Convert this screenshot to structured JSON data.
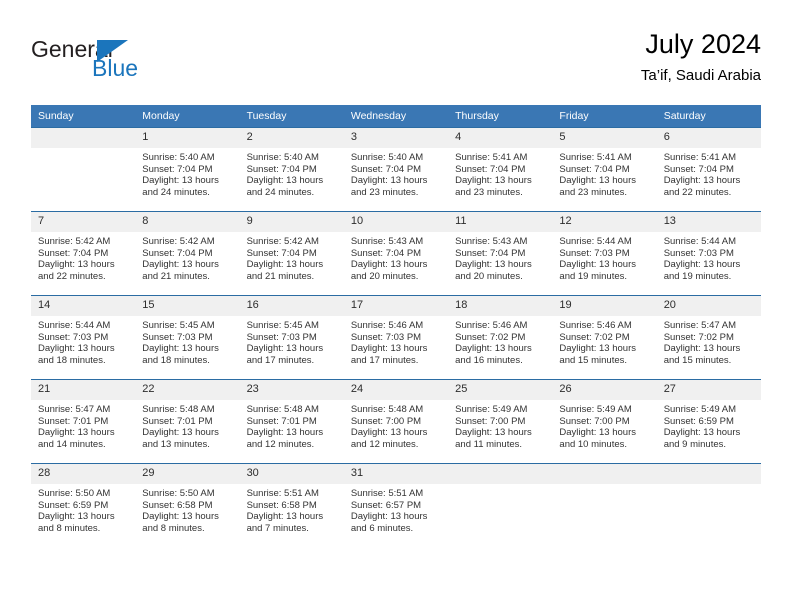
{
  "brand": {
    "name_part1": "General",
    "name_part2": "Blue",
    "accent_color": "#1b75bc"
  },
  "header": {
    "title": "July 2024",
    "subtitle": "Ta’if, Saudi Arabia"
  },
  "theme": {
    "header_row_bg": "#3a77b4",
    "daynum_bg": "#f0f0f0",
    "row_border": "#2b6ca3"
  },
  "columns": [
    "Sunday",
    "Monday",
    "Tuesday",
    "Wednesday",
    "Thursday",
    "Friday",
    "Saturday"
  ],
  "weeks": [
    [
      {
        "day": "",
        "sunrise": "",
        "sunset": "",
        "daylight_line1": "",
        "daylight_line2": "",
        "blank": true
      },
      {
        "day": "1",
        "sunrise": "Sunrise: 5:40 AM",
        "sunset": "Sunset: 7:04 PM",
        "daylight_line1": "Daylight: 13 hours",
        "daylight_line2": "and 24 minutes."
      },
      {
        "day": "2",
        "sunrise": "Sunrise: 5:40 AM",
        "sunset": "Sunset: 7:04 PM",
        "daylight_line1": "Daylight: 13 hours",
        "daylight_line2": "and 24 minutes."
      },
      {
        "day": "3",
        "sunrise": "Sunrise: 5:40 AM",
        "sunset": "Sunset: 7:04 PM",
        "daylight_line1": "Daylight: 13 hours",
        "daylight_line2": "and 23 minutes."
      },
      {
        "day": "4",
        "sunrise": "Sunrise: 5:41 AM",
        "sunset": "Sunset: 7:04 PM",
        "daylight_line1": "Daylight: 13 hours",
        "daylight_line2": "and 23 minutes."
      },
      {
        "day": "5",
        "sunrise": "Sunrise: 5:41 AM",
        "sunset": "Sunset: 7:04 PM",
        "daylight_line1": "Daylight: 13 hours",
        "daylight_line2": "and 23 minutes."
      },
      {
        "day": "6",
        "sunrise": "Sunrise: 5:41 AM",
        "sunset": "Sunset: 7:04 PM",
        "daylight_line1": "Daylight: 13 hours",
        "daylight_line2": "and 22 minutes."
      }
    ],
    [
      {
        "day": "7",
        "sunrise": "Sunrise: 5:42 AM",
        "sunset": "Sunset: 7:04 PM",
        "daylight_line1": "Daylight: 13 hours",
        "daylight_line2": "and 22 minutes."
      },
      {
        "day": "8",
        "sunrise": "Sunrise: 5:42 AM",
        "sunset": "Sunset: 7:04 PM",
        "daylight_line1": "Daylight: 13 hours",
        "daylight_line2": "and 21 minutes."
      },
      {
        "day": "9",
        "sunrise": "Sunrise: 5:42 AM",
        "sunset": "Sunset: 7:04 PM",
        "daylight_line1": "Daylight: 13 hours",
        "daylight_line2": "and 21 minutes."
      },
      {
        "day": "10",
        "sunrise": "Sunrise: 5:43 AM",
        "sunset": "Sunset: 7:04 PM",
        "daylight_line1": "Daylight: 13 hours",
        "daylight_line2": "and 20 minutes."
      },
      {
        "day": "11",
        "sunrise": "Sunrise: 5:43 AM",
        "sunset": "Sunset: 7:04 PM",
        "daylight_line1": "Daylight: 13 hours",
        "daylight_line2": "and 20 minutes."
      },
      {
        "day": "12",
        "sunrise": "Sunrise: 5:44 AM",
        "sunset": "Sunset: 7:03 PM",
        "daylight_line1": "Daylight: 13 hours",
        "daylight_line2": "and 19 minutes."
      },
      {
        "day": "13",
        "sunrise": "Sunrise: 5:44 AM",
        "sunset": "Sunset: 7:03 PM",
        "daylight_line1": "Daylight: 13 hours",
        "daylight_line2": "and 19 minutes."
      }
    ],
    [
      {
        "day": "14",
        "sunrise": "Sunrise: 5:44 AM",
        "sunset": "Sunset: 7:03 PM",
        "daylight_line1": "Daylight: 13 hours",
        "daylight_line2": "and 18 minutes."
      },
      {
        "day": "15",
        "sunrise": "Sunrise: 5:45 AM",
        "sunset": "Sunset: 7:03 PM",
        "daylight_line1": "Daylight: 13 hours",
        "daylight_line2": "and 18 minutes."
      },
      {
        "day": "16",
        "sunrise": "Sunrise: 5:45 AM",
        "sunset": "Sunset: 7:03 PM",
        "daylight_line1": "Daylight: 13 hours",
        "daylight_line2": "and 17 minutes."
      },
      {
        "day": "17",
        "sunrise": "Sunrise: 5:46 AM",
        "sunset": "Sunset: 7:03 PM",
        "daylight_line1": "Daylight: 13 hours",
        "daylight_line2": "and 17 minutes."
      },
      {
        "day": "18",
        "sunrise": "Sunrise: 5:46 AM",
        "sunset": "Sunset: 7:02 PM",
        "daylight_line1": "Daylight: 13 hours",
        "daylight_line2": "and 16 minutes."
      },
      {
        "day": "19",
        "sunrise": "Sunrise: 5:46 AM",
        "sunset": "Sunset: 7:02 PM",
        "daylight_line1": "Daylight: 13 hours",
        "daylight_line2": "and 15 minutes."
      },
      {
        "day": "20",
        "sunrise": "Sunrise: 5:47 AM",
        "sunset": "Sunset: 7:02 PM",
        "daylight_line1": "Daylight: 13 hours",
        "daylight_line2": "and 15 minutes."
      }
    ],
    [
      {
        "day": "21",
        "sunrise": "Sunrise: 5:47 AM",
        "sunset": "Sunset: 7:01 PM",
        "daylight_line1": "Daylight: 13 hours",
        "daylight_line2": "and 14 minutes."
      },
      {
        "day": "22",
        "sunrise": "Sunrise: 5:48 AM",
        "sunset": "Sunset: 7:01 PM",
        "daylight_line1": "Daylight: 13 hours",
        "daylight_line2": "and 13 minutes."
      },
      {
        "day": "23",
        "sunrise": "Sunrise: 5:48 AM",
        "sunset": "Sunset: 7:01 PM",
        "daylight_line1": "Daylight: 13 hours",
        "daylight_line2": "and 12 minutes."
      },
      {
        "day": "24",
        "sunrise": "Sunrise: 5:48 AM",
        "sunset": "Sunset: 7:00 PM",
        "daylight_line1": "Daylight: 13 hours",
        "daylight_line2": "and 12 minutes."
      },
      {
        "day": "25",
        "sunrise": "Sunrise: 5:49 AM",
        "sunset": "Sunset: 7:00 PM",
        "daylight_line1": "Daylight: 13 hours",
        "daylight_line2": "and 11 minutes."
      },
      {
        "day": "26",
        "sunrise": "Sunrise: 5:49 AM",
        "sunset": "Sunset: 7:00 PM",
        "daylight_line1": "Daylight: 13 hours",
        "daylight_line2": "and 10 minutes."
      },
      {
        "day": "27",
        "sunrise": "Sunrise: 5:49 AM",
        "sunset": "Sunset: 6:59 PM",
        "daylight_line1": "Daylight: 13 hours",
        "daylight_line2": "and 9 minutes."
      }
    ],
    [
      {
        "day": "28",
        "sunrise": "Sunrise: 5:50 AM",
        "sunset": "Sunset: 6:59 PM",
        "daylight_line1": "Daylight: 13 hours",
        "daylight_line2": "and 8 minutes."
      },
      {
        "day": "29",
        "sunrise": "Sunrise: 5:50 AM",
        "sunset": "Sunset: 6:58 PM",
        "daylight_line1": "Daylight: 13 hours",
        "daylight_line2": "and 8 minutes."
      },
      {
        "day": "30",
        "sunrise": "Sunrise: 5:51 AM",
        "sunset": "Sunset: 6:58 PM",
        "daylight_line1": "Daylight: 13 hours",
        "daylight_line2": "and 7 minutes."
      },
      {
        "day": "31",
        "sunrise": "Sunrise: 5:51 AM",
        "sunset": "Sunset: 6:57 PM",
        "daylight_line1": "Daylight: 13 hours",
        "daylight_line2": "and 6 minutes."
      },
      {
        "day": "",
        "sunrise": "",
        "sunset": "",
        "daylight_line1": "",
        "daylight_line2": "",
        "blank": true
      },
      {
        "day": "",
        "sunrise": "",
        "sunset": "",
        "daylight_line1": "",
        "daylight_line2": "",
        "blank": true
      },
      {
        "day": "",
        "sunrise": "",
        "sunset": "",
        "daylight_line1": "",
        "daylight_line2": "",
        "blank": true
      }
    ]
  ]
}
